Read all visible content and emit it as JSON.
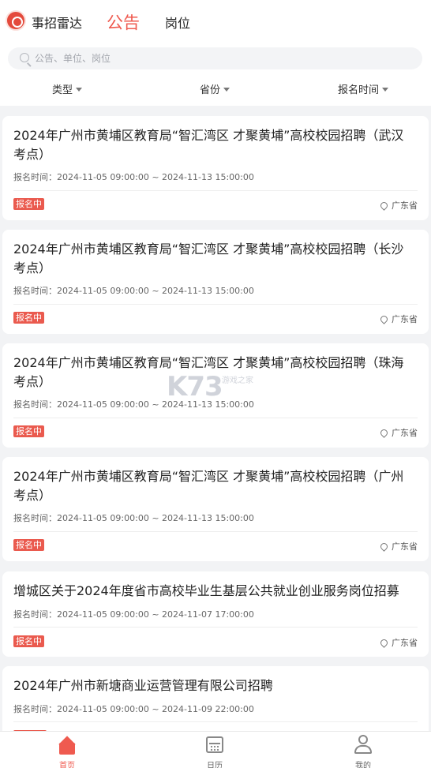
{
  "header": {
    "brand": "事招雷达",
    "tabs": [
      {
        "label": "公告",
        "active": true
      },
      {
        "label": "岗位",
        "active": false
      }
    ],
    "search": {
      "placeholder": "公告、单位、岗位",
      "value": ""
    },
    "filters": [
      "类型",
      "省份",
      "报名时间"
    ]
  },
  "listings": [
    {
      "title": "2024年广州市黄埔区教育局“智汇湾区 才聚黄埔”高校校园招聘（武汉考点）",
      "time": "报名时间：2024-11-05 09:00:00 ~ 2024-11-13 15:00:00",
      "status": "报名中",
      "location": "广东省"
    },
    {
      "title": "2024年广州市黄埔区教育局“智汇湾区 才聚黄埔”高校校园招聘（长沙考点）",
      "time": "报名时间：2024-11-05 09:00:00 ~ 2024-11-13 15:00:00",
      "status": "报名中",
      "location": "广东省"
    },
    {
      "title": "2024年广州市黄埔区教育局“智汇湾区 才聚黄埔”高校校园招聘（珠海考点）",
      "time": "报名时间：2024-11-05 09:00:00 ~ 2024-11-13 15:00:00",
      "status": "报名中",
      "location": "广东省"
    },
    {
      "title": "2024年广州市黄埔区教育局“智汇湾区 才聚黄埔”高校校园招聘（广州考点）",
      "time": "报名时间：2024-11-05 09:00:00 ~ 2024-11-13 15:00:00",
      "status": "报名中",
      "location": "广东省"
    },
    {
      "title": "增城区关于2024年度省市高校毕业生基层公共就业创业服务岗位招募",
      "time": "报名时间：2024-11-05 09:00:00 ~ 2024-11-07 17:00:00",
      "status": "报名中",
      "location": "广东省"
    },
    {
      "title": "2024年广州市新塘商业运营管理有限公司招聘",
      "time": "报名时间：2024-11-05 09:00:00 ~ 2024-11-09 22:00:00",
      "status": "",
      "location": ""
    }
  ],
  "tabbar": [
    {
      "label": "首页",
      "icon": "home-icon",
      "active": true
    },
    {
      "label": "日历",
      "icon": "calendar-icon",
      "active": false
    },
    {
      "label": "我的",
      "icon": "user-icon",
      "active": false
    }
  ],
  "watermark": {
    "text": "K73",
    "subtext": "游戏之家"
  },
  "colors": {
    "accent": "#ef5a4f",
    "badge": "#ea5a4e",
    "background": "#f2f3f5"
  }
}
